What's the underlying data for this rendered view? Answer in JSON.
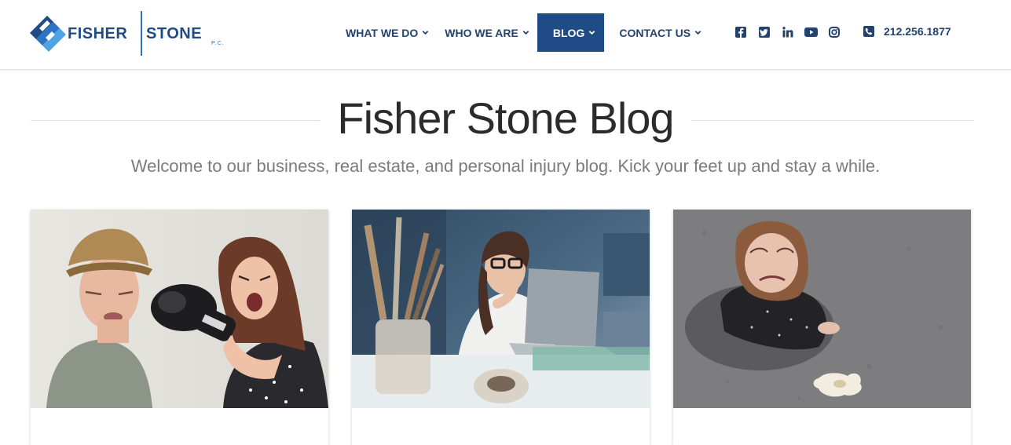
{
  "brand": {
    "name_left": "FISHER",
    "name_right": "STONE",
    "suffix": "P.C.",
    "colors": {
      "navy": "#1f4b86",
      "accent": "#2d73c4",
      "light": "#4fa3e0"
    }
  },
  "nav": {
    "items": [
      {
        "label": "WHAT WE DO",
        "has_dropdown": true,
        "active": false
      },
      {
        "label": "WHO WE ARE",
        "has_dropdown": true,
        "active": false
      },
      {
        "label": "BLOG",
        "has_dropdown": true,
        "active": true
      },
      {
        "label": "CONTACT US",
        "has_dropdown": true,
        "active": false
      }
    ],
    "social_icons": [
      "facebook-icon",
      "twitter-icon",
      "linkedin-icon",
      "youtube-icon",
      "instagram-icon"
    ],
    "phone": "212.256.1877",
    "phone_icon": "phone-icon"
  },
  "hero": {
    "title": "Fisher Stone Blog",
    "subtitle": "Welcome to our business, real estate, and personal injury blog. Kick your feet up and stay a while."
  },
  "posts": [
    {
      "image": "couple-boxing-photo"
    },
    {
      "image": "woman-thinking-at-laptop-photo"
    },
    {
      "image": "woman-crying-over-spilled-milk-photo"
    }
  ]
}
